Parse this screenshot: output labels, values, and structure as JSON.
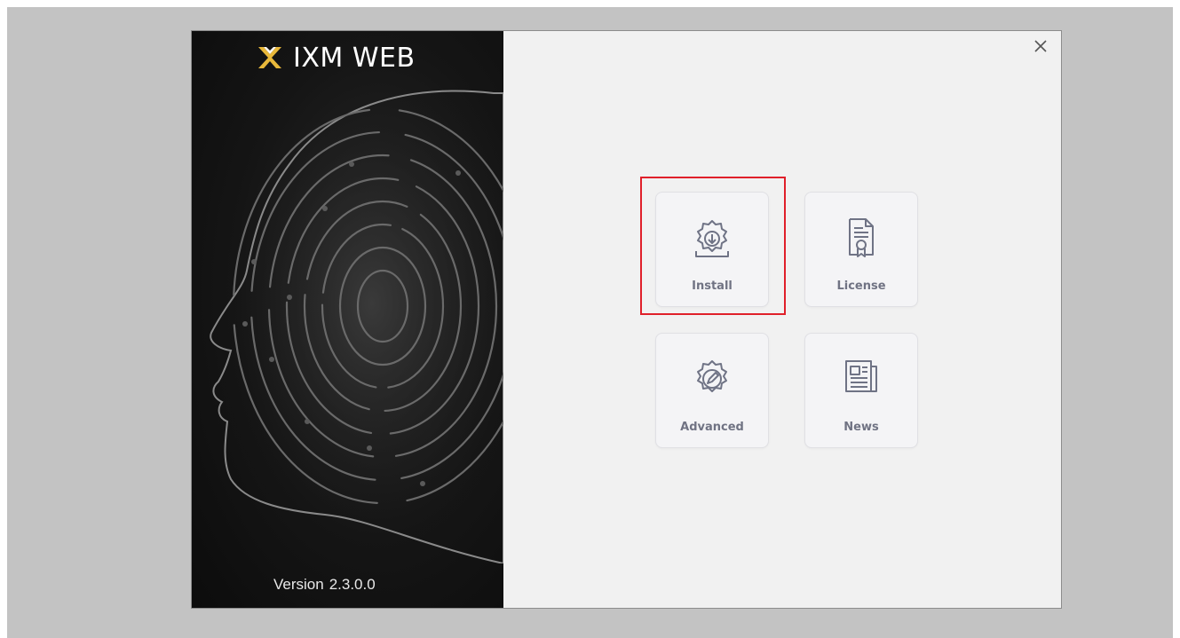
{
  "app": {
    "logo_text": "IXM WEB",
    "version_label": "Version",
    "version_number": "2.3.0.0"
  },
  "tiles": [
    {
      "label": "Install",
      "icon": "gear-download-icon"
    },
    {
      "label": "License",
      "icon": "certificate-icon"
    },
    {
      "label": "Advanced",
      "icon": "gear-pencil-icon"
    },
    {
      "label": "News",
      "icon": "newspaper-icon"
    }
  ],
  "close_icon": "close-icon",
  "colors": {
    "highlight": "#e0202a",
    "tile_icon": "#6f7385",
    "logo_x": "#e8b83a"
  }
}
